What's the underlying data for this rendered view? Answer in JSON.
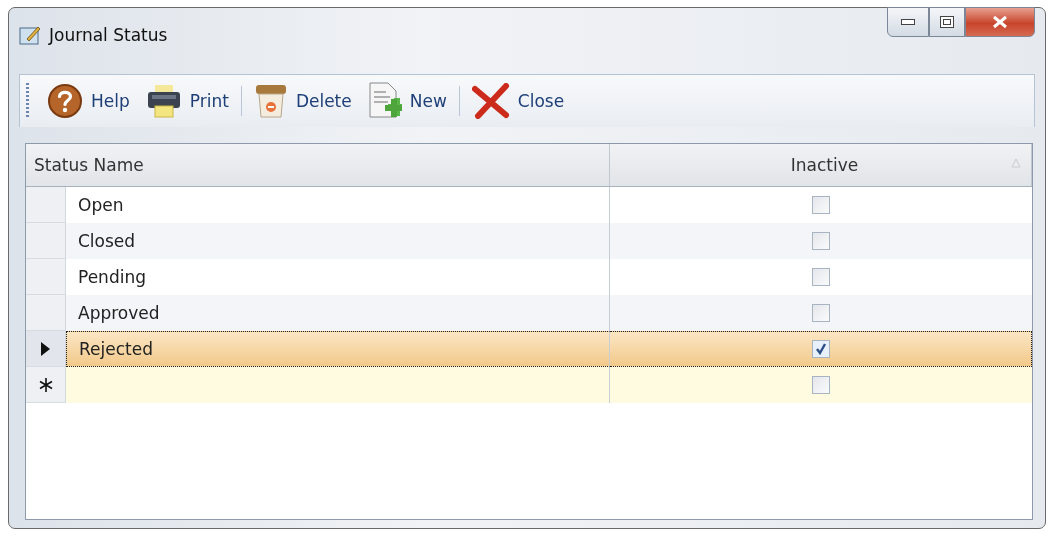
{
  "window": {
    "title": "Journal Status"
  },
  "toolbar": [
    {
      "kind": "help",
      "label": "Help"
    },
    {
      "kind": "print",
      "label": "Print"
    },
    {
      "kind": "separator"
    },
    {
      "kind": "delete",
      "label": "Delete"
    },
    {
      "kind": "new",
      "label": "New"
    },
    {
      "kind": "separator"
    },
    {
      "kind": "close",
      "label": "Close"
    }
  ],
  "table": {
    "columns": [
      {
        "label": "Status Name",
        "sorted": false
      },
      {
        "label": "Inactive",
        "sorted": true
      }
    ],
    "rows": [
      {
        "kind": "data",
        "name": "Open",
        "inactive": false,
        "selected": false
      },
      {
        "kind": "data",
        "name": "Closed",
        "inactive": false,
        "selected": false
      },
      {
        "kind": "data",
        "name": "Pending",
        "inactive": false,
        "selected": false
      },
      {
        "kind": "data",
        "name": "Approved",
        "inactive": false,
        "selected": false
      },
      {
        "kind": "data",
        "name": "Rejected",
        "inactive": true,
        "selected": true
      },
      {
        "kind": "new",
        "inactive": false,
        "selected": false
      }
    ]
  }
}
